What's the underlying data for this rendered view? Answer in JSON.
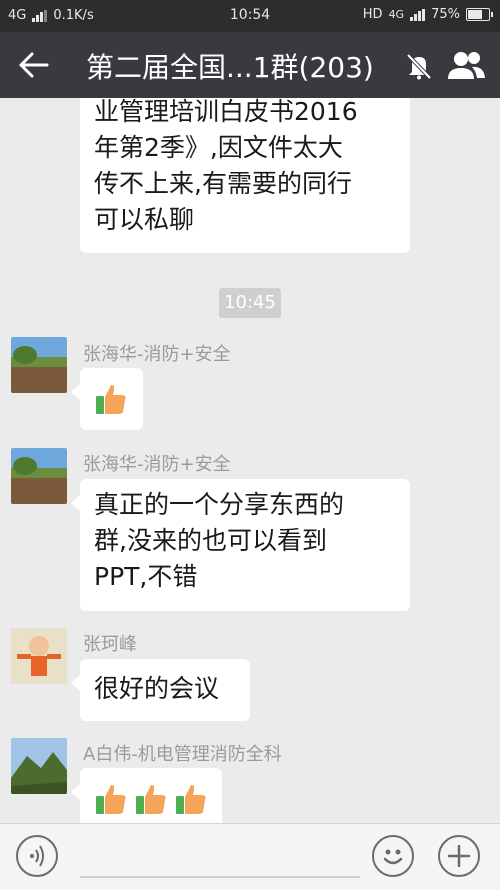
{
  "status_bar": {
    "network": "4G",
    "speed": "0.1K/s",
    "time": "10:54",
    "hd": "HD",
    "network_right": "4G",
    "battery": "75%",
    "battery_level": 0.75
  },
  "header": {
    "title": "第二届全国...1群(203)",
    "back_icon": "back-arrow-icon",
    "mute_icon": "mute-bell-icon",
    "members_icon": "group-members-icon"
  },
  "messages": [
    {
      "lines": [
        "业管理培训白皮书2016",
        "年第2季》,因文件太大",
        "传不上来,有需要的同行",
        "可以私聊"
      ]
    },
    {
      "timestamp": "10:45"
    },
    {
      "sender": "张海华-消防+安全",
      "content_icon": "thumbs-up-icon",
      "thumbs": 1
    },
    {
      "sender": "张海华-消防+安全",
      "lines": [
        "真正的一个分享东西的",
        "群,没来的也可以看到",
        "PPT,不错"
      ]
    },
    {
      "sender": "张珂峰",
      "lines": [
        "很好的会议"
      ]
    },
    {
      "sender": "A白伟-机电管理消防全科",
      "content_icon": "thumbs-up-icon",
      "thumbs": 3
    }
  ],
  "input_bar": {
    "voice_icon": "voice-icon",
    "emoji_icon": "emoji-icon",
    "plus_icon": "plus-icon"
  }
}
